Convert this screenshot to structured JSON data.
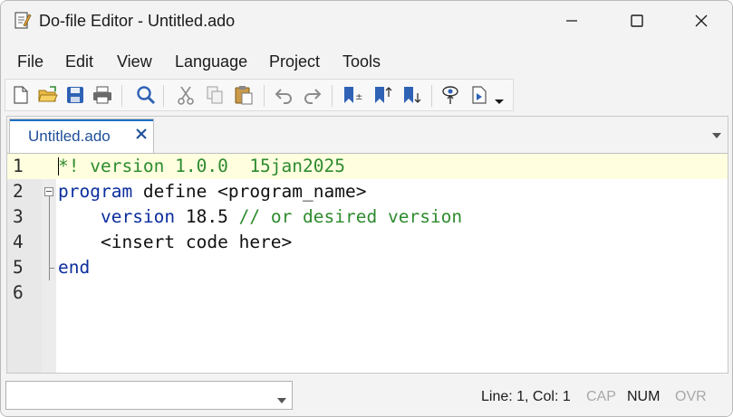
{
  "window": {
    "title": "Do-file Editor - Untitled.ado"
  },
  "menu": [
    "File",
    "Edit",
    "View",
    "Language",
    "Project",
    "Tools"
  ],
  "toolbar": {
    "buttons": [
      "new-file-icon",
      "open-file-icon",
      "save-icon",
      "print-icon",
      "find-icon",
      "cut-icon",
      "copy-icon",
      "paste-icon",
      "undo-icon",
      "redo-icon",
      "toggle-bookmark-icon",
      "previous-bookmark-icon",
      "next-bookmark-icon",
      "show-file-icon",
      "execute-icon",
      "execute-dropdown-icon"
    ]
  },
  "tab": {
    "label": "Untitled.ado",
    "close_glyph": "✕"
  },
  "editor": {
    "line_numbers": [
      "1",
      "2",
      "3",
      "4",
      "5",
      "6"
    ],
    "lines": [
      {
        "tokens": [
          {
            "t": "*! version 1.0.0  15jan2025",
            "k": "comment"
          }
        ]
      },
      {
        "tokens": [
          {
            "t": "program",
            "k": "kw"
          },
          {
            "t": " define <program_name>",
            "k": "plain"
          }
        ]
      },
      {
        "tokens": [
          {
            "t": "    ",
            "k": "plain"
          },
          {
            "t": "version",
            "k": "kw"
          },
          {
            "t": " 18.5 ",
            "k": "plain"
          },
          {
            "t": "// or desired version",
            "k": "comment"
          }
        ]
      },
      {
        "tokens": [
          {
            "t": "    <insert code here>",
            "k": "plain"
          }
        ]
      },
      {
        "tokens": [
          {
            "t": "end",
            "k": "kw"
          }
        ]
      },
      {
        "tokens": []
      }
    ]
  },
  "status": {
    "position": "Line: 1, Col: 1",
    "cap": "CAP",
    "num": "NUM",
    "ovr": "OVR"
  },
  "colors": {
    "comment": "#2e8b2e",
    "keyword": "#0b2e9e",
    "current_line": "#ffffe0",
    "accent": "#1f6fc1",
    "indicator_active": "#1a1a1a",
    "indicator_inactive": "#a8a8a8"
  }
}
